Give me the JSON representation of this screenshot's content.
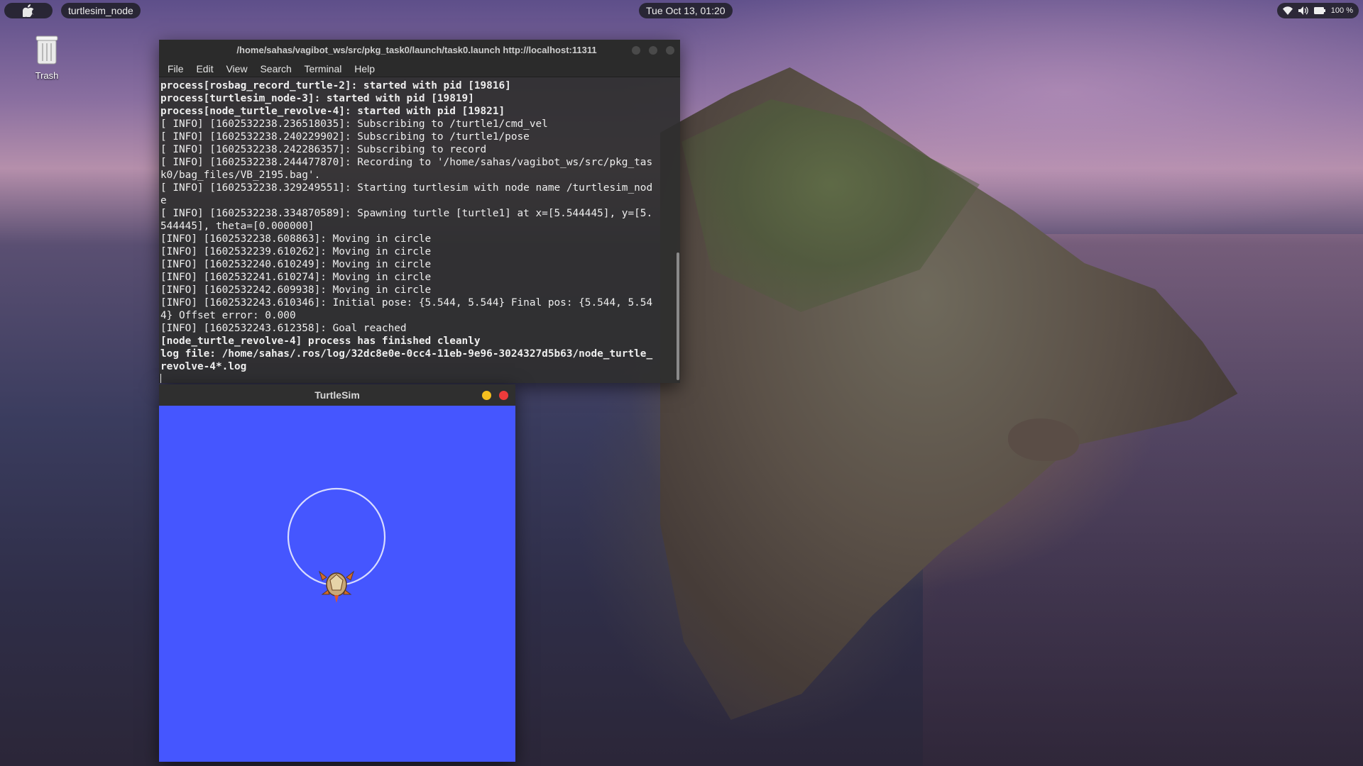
{
  "topbar": {
    "apple_icon": "apple-logo",
    "active_app": "turtlesim_node",
    "clock": "Tue Oct 13, 01:20",
    "battery": "100 %"
  },
  "desktop": {
    "trash_label": "Trash"
  },
  "terminal": {
    "title": "/home/sahas/vagibot_ws/src/pkg_task0/launch/task0.launch http://localhost:11311",
    "menu": [
      "File",
      "Edit",
      "View",
      "Search",
      "Terminal",
      "Help"
    ],
    "lines": [
      {
        "text": "process[rosbag_record_turtle-2]: started with pid [19816]",
        "bold": true
      },
      {
        "text": "process[turtlesim_node-3]: started with pid [19819]",
        "bold": true
      },
      {
        "text": "process[node_turtle_revolve-4]: started with pid [19821]",
        "bold": true
      },
      {
        "text": "[ INFO] [1602532238.236518035]: Subscribing to /turtle1/cmd_vel",
        "bold": false
      },
      {
        "text": "[ INFO] [1602532238.240229902]: Subscribing to /turtle1/pose",
        "bold": false
      },
      {
        "text": "[ INFO] [1602532238.242286357]: Subscribing to record",
        "bold": false
      },
      {
        "text": "[ INFO] [1602532238.244477870]: Recording to '/home/sahas/vagibot_ws/src/pkg_tas",
        "bold": false
      },
      {
        "text": "k0/bag_files/VB_2195.bag'.",
        "bold": false
      },
      {
        "text": "[ INFO] [1602532238.329249551]: Starting turtlesim with node name /turtlesim_nod",
        "bold": false
      },
      {
        "text": "e",
        "bold": false
      },
      {
        "text": "[ INFO] [1602532238.334870589]: Spawning turtle [turtle1] at x=[5.544445], y=[5.",
        "bold": false
      },
      {
        "text": "544445], theta=[0.000000]",
        "bold": false
      },
      {
        "text": "[INFO] [1602532238.608863]: Moving in circle",
        "bold": false
      },
      {
        "text": "[INFO] [1602532239.610262]: Moving in circle",
        "bold": false
      },
      {
        "text": "[INFO] [1602532240.610249]: Moving in circle",
        "bold": false
      },
      {
        "text": "[INFO] [1602532241.610274]: Moving in circle",
        "bold": false
      },
      {
        "text": "[INFO] [1602532242.609938]: Moving in circle",
        "bold": false
      },
      {
        "text": "[INFO] [1602532243.610346]: Initial pose: {5.544, 5.544} Final pos: {5.544, 5.54",
        "bold": false
      },
      {
        "text": "4} Offset error: 0.000",
        "bold": false
      },
      {
        "text": "[INFO] [1602532243.612358]: Goal reached",
        "bold": false
      },
      {
        "text": "[node_turtle_revolve-4] process has finished cleanly",
        "bold": true
      },
      {
        "text": "log file: /home/sahas/.ros/log/32dc8e0e-0cc4-11eb-9e96-3024327d5b63/node_turtle_",
        "bold": true
      },
      {
        "text": "revolve-4*.log",
        "bold": true
      }
    ]
  },
  "turtlesim": {
    "title": "TurtleSim",
    "background_color": "#4556ff",
    "trail_color": "#d8dcff",
    "minimize_color": "#f5bf1f",
    "close_color": "#ed3b3b",
    "turtle_icon": "turtle-icon"
  }
}
